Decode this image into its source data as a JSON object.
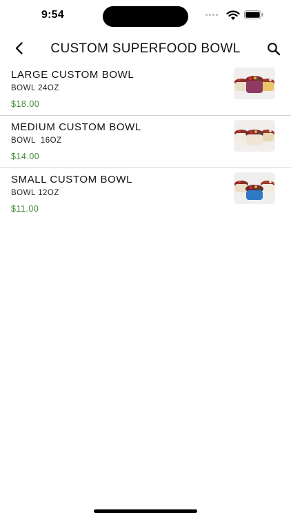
{
  "status_bar": {
    "time": "9:54"
  },
  "header": {
    "title": "CUSTOM SUPERFOOD BOWL",
    "back_icon": "chevron-left-icon",
    "search_icon": "search-icon"
  },
  "items": [
    {
      "name": "LARGE CUSTOM BOWL",
      "description": "BOWL 24OZ",
      "price": "$18.00",
      "bowl_color": "#8e3a63"
    },
    {
      "name": "MEDIUM CUSTOM BOWL",
      "description": "BOWL  16OZ",
      "price": "$14.00",
      "bowl_color": "#efe6d3"
    },
    {
      "name": "SMALL CUSTOM BOWL",
      "description": "BOWL 12OZ",
      "price": "$11.00",
      "bowl_color": "#2f78c4"
    }
  ],
  "colors": {
    "price": "#3d8a32",
    "divider": "#d3d3d3"
  }
}
